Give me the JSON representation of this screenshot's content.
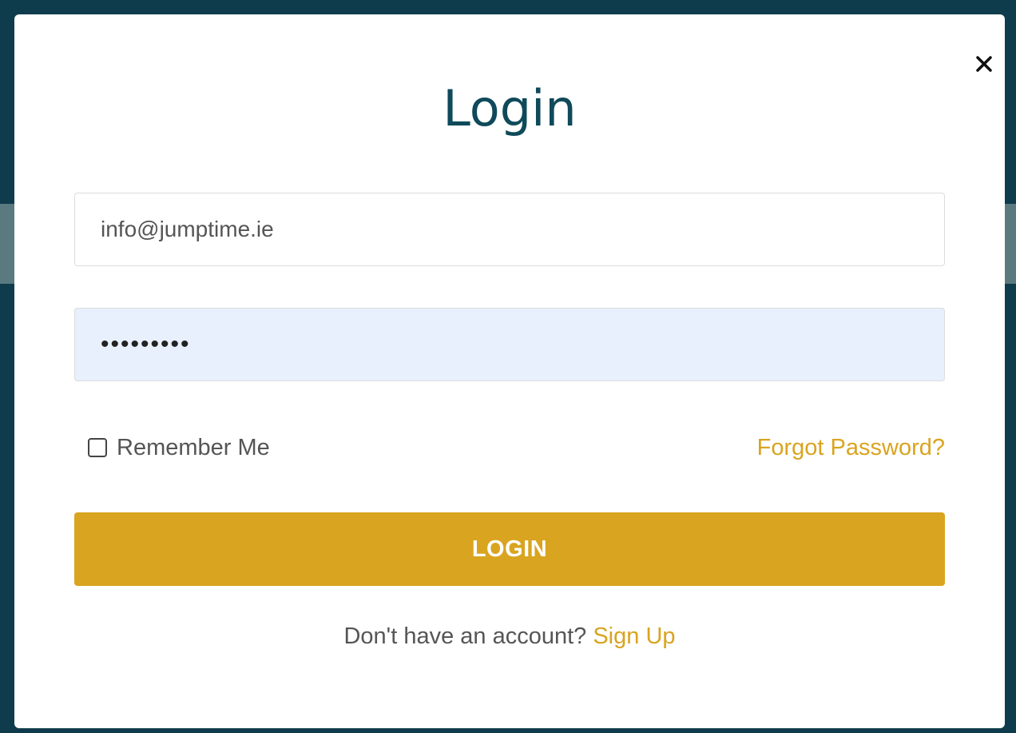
{
  "modal": {
    "title": "Login",
    "close_icon": "close-icon"
  },
  "form": {
    "email_value": "info@jumptime.ie",
    "password_value": "•••••••••",
    "remember_label": "Remember Me",
    "remember_checked": false,
    "forgot_label": "Forgot Password?",
    "login_label": "LOGIN"
  },
  "footer": {
    "prompt": "Don't have an account?",
    "signup_label": "Sign Up"
  },
  "colors": {
    "accent": "#d9a41f",
    "title": "#0f4a5a",
    "autofill_bg": "#e8f0fe",
    "backdrop": "#0f3c4c"
  }
}
